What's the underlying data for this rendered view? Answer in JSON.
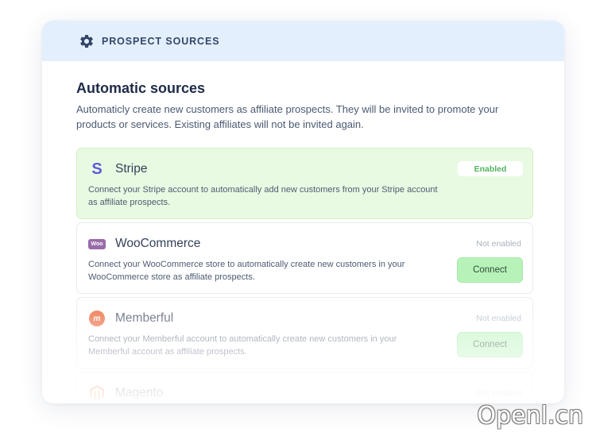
{
  "header": {
    "title": "PROSPECT SOURCES",
    "icon": "gear-icon"
  },
  "section": {
    "title": "Automatic sources",
    "description": "Automaticly create new customers as affiliate prospects. They will be invited to promote your products or services. Existing affiliates will not be invited again."
  },
  "sources": [
    {
      "name": "Stripe",
      "description": "Connect your Stripe account to automatically add new customers from your Stripe account as affiliate prospects.",
      "status": "Enabled",
      "logo": "stripe-logo",
      "logo_text": "S"
    },
    {
      "name": "WooCommerce",
      "description": "Connect your WooCommerce store to automatically create new customers in your WooCommerce store as affiliate prospects.",
      "status": "Not enabled",
      "button": "Connect",
      "logo": "woocommerce-logo",
      "logo_text": "Woo"
    },
    {
      "name": "Memberful",
      "description": "Connect your Memberful account to automatically create new customers in your Memberful account as affiliate prospects.",
      "status": "Not enabled",
      "button": "Connect",
      "logo": "memberful-logo",
      "logo_text": "m"
    },
    {
      "name": "Magento",
      "status": "Not enabled",
      "logo": "magento-logo"
    }
  ],
  "watermark": "Openl.cn",
  "colors": {
    "header_bg": "#e3effc",
    "enabled_bg": "#e9fae2",
    "enabled_text": "#52b35e",
    "connect_bg": "#b7f3b9",
    "stripe": "#5f5bd6",
    "woocommerce": "#9a6bab",
    "memberful": "#ea5b2a",
    "magento": "#ee672f"
  }
}
